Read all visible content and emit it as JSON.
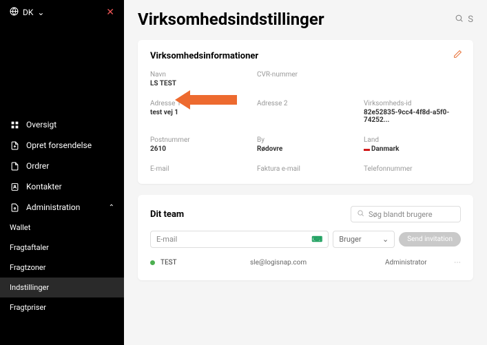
{
  "lang": {
    "label": "DK"
  },
  "sidebar": {
    "items": {
      "overview": "Oversigt",
      "create": "Opret forsendelse",
      "orders": "Ordrer",
      "contacts": "Kontakter",
      "admin": "Administration"
    },
    "subs": {
      "wallet": "Wallet",
      "agreements": "Fragtaftaler",
      "zones": "Fragtzoner",
      "settings": "Indstillinger",
      "prices": "Fragtpriser"
    }
  },
  "page": {
    "title": "Virksomhedsindstillinger",
    "searchPlaceholder": "S"
  },
  "company": {
    "section_title": "Virksomhedsinformationer",
    "labels": {
      "name": "Navn",
      "cvr": "CVR-nummer",
      "addr1": "Adresse 1",
      "addr2": "Adresse 2",
      "cid": "Virksomheds-id",
      "zip": "Postnummer",
      "city": "By",
      "country": "Land",
      "email": "E-mail",
      "invoice": "Faktura e-mail",
      "phone": "Telefonnummer"
    },
    "values": {
      "name": "LS TEST",
      "addr1": "test vej 1",
      "cid": "82e52835-9cc4-4f8d-a5f0-74252...",
      "zip": "2610",
      "city": "Rødovre",
      "country": "Danmark"
    }
  },
  "team": {
    "section_title": "Dit team",
    "search_placeholder": "Søg blandt brugere",
    "email_placeholder": "E-mail",
    "role_placeholder": "Bruger",
    "send_button": "Send invitation",
    "users": [
      {
        "name": "TEST",
        "email": "sle@logisnap.com",
        "role": "Administrator"
      }
    ]
  }
}
